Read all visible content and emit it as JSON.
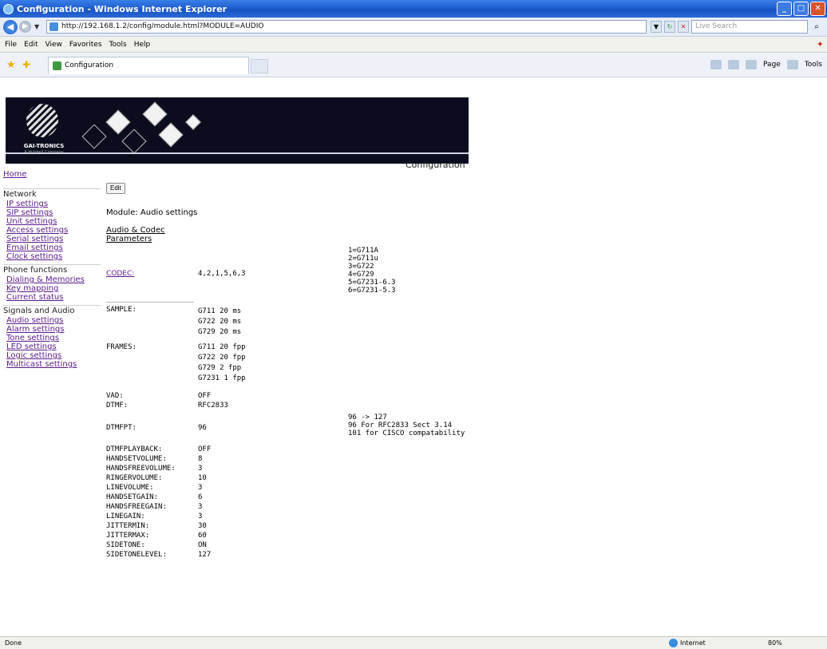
{
  "window": {
    "title": "Configuration - Windows Internet Explorer"
  },
  "address": {
    "url": "http://192.168.1.2/config/module.html?MODULE=AUDIO",
    "search_placeholder": "Live Search"
  },
  "menu": {
    "items": [
      "File",
      "Edit",
      "View",
      "Favorites",
      "Tools",
      "Help"
    ]
  },
  "tab": {
    "label": "Configuration"
  },
  "commands": {
    "page": "Page",
    "tools": "Tools"
  },
  "banner": {
    "company": "GAI-TRONICS",
    "tagline": "A Hubbell Company"
  },
  "page": {
    "title": "Configuration",
    "edit_label": "Edit",
    "module_title": "Module: Audio settings",
    "section_head": "Audio & Codec Parameters"
  },
  "sidebar": {
    "home": "Home",
    "groups": [
      {
        "heading": "Network",
        "links": [
          "IP settings",
          "SIP settings",
          "Unit settings",
          "Access settings",
          "Serial settings",
          "Email settings",
          "Clock settings"
        ]
      },
      {
        "heading": "Phone functions",
        "links": [
          "Dialing & Memories",
          "Key mapping",
          "Current status"
        ]
      },
      {
        "heading": "Signals and Audio",
        "links": [
          "Audio settings",
          "Alarm settings",
          "Tone settings",
          "LED settings",
          "Logic settings",
          "Multicast settings"
        ]
      }
    ]
  },
  "codec": {
    "label": "CODEC:",
    "value": "4,2,1,5,6,3",
    "notes": [
      "1=G711A",
      "2=G711u",
      "3=G722",
      "4=G729",
      "5=G7231-6.3",
      "6=G7231-5.3"
    ]
  },
  "sample": {
    "label": "SAMPLE:",
    "values": [
      "G711 20 ms",
      "G722 20 ms",
      "G729 20 ms"
    ]
  },
  "frames": {
    "label": "FRAMES:",
    "values": [
      "G711  20 fpp",
      "G722  20 fpp",
      "G729  2  fpp",
      "G7231 1  fpp"
    ]
  },
  "vad": {
    "label": "VAD:",
    "value": "OFF"
  },
  "dtmf": {
    "label": "DTMF:",
    "value": "RFC2833"
  },
  "dtmfpt": {
    "label": "DTMFPT:",
    "value": "96",
    "notes": [
      "96 -> 127",
      "96 For RFC2833 Sect 3.14",
      "101 for CISCO compatability"
    ]
  },
  "params": [
    {
      "name": "DTMFPLAYBACK:",
      "value": "OFF"
    },
    {
      "name": "HANDSETVOLUME:",
      "value": "8"
    },
    {
      "name": "HANDSFREEVOLUME:",
      "value": "3"
    },
    {
      "name": "RINGERVOLUME:",
      "value": "10"
    },
    {
      "name": "LINEVOLUME:",
      "value": "3"
    },
    {
      "name": "HANDSETGAIN:",
      "value": "6"
    },
    {
      "name": "HANDSFREEGAIN:",
      "value": "3"
    },
    {
      "name": "LINEGAIN:",
      "value": "3"
    },
    {
      "name": "JITTERMIN:",
      "value": "30"
    },
    {
      "name": "JITTERMAX:",
      "value": "60"
    },
    {
      "name": "SIDETONE:",
      "value": "ON"
    },
    {
      "name": "SIDETONELEVEL:",
      "value": "127"
    }
  ],
  "status": {
    "left": "Done",
    "zone": "Internet",
    "zoom": "80%"
  }
}
